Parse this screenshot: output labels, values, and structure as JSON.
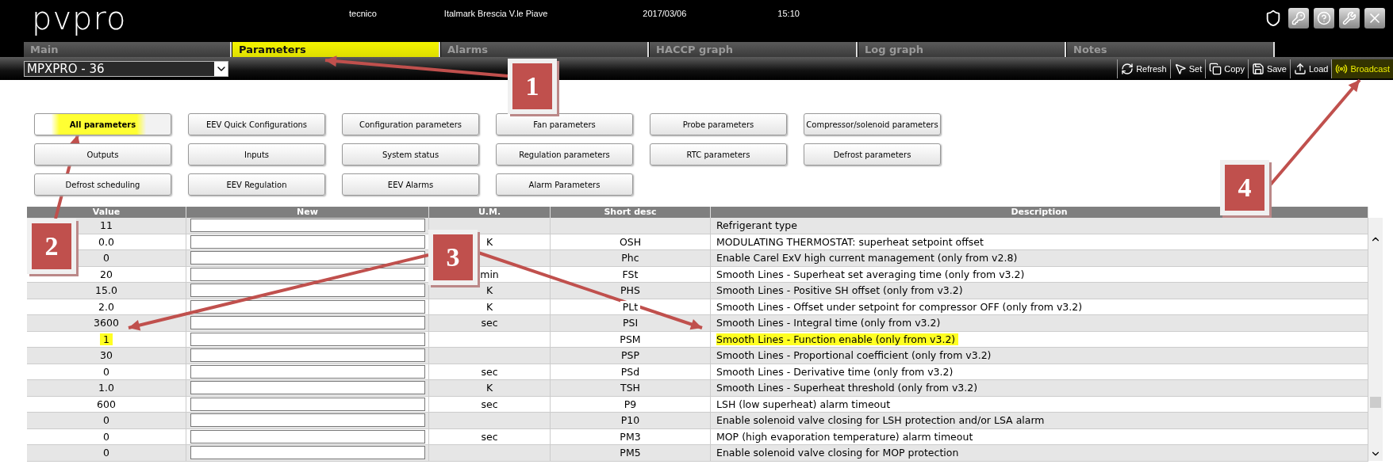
{
  "header": {
    "logo": "pvpro",
    "user": "tecnico",
    "site": "Italmark Brescia V.le Piave",
    "date": "2017/03/06",
    "time": "15:10"
  },
  "tabs": [
    {
      "label": "Main",
      "selected": false
    },
    {
      "label": "Parameters",
      "selected": true
    },
    {
      "label": "Alarms",
      "selected": false
    },
    {
      "label": "HACCP graph",
      "selected": false
    },
    {
      "label": "Log graph",
      "selected": false
    },
    {
      "label": "Notes",
      "selected": false
    }
  ],
  "device_select": {
    "value": "MPXPRO - 36"
  },
  "toolbar": [
    {
      "label": "Refresh",
      "kind": "refresh",
      "highlighted": false
    },
    {
      "label": "Set",
      "kind": "set",
      "highlighted": false
    },
    {
      "label": "Copy",
      "kind": "copy",
      "highlighted": false
    },
    {
      "label": "Save",
      "kind": "save",
      "highlighted": false
    },
    {
      "label": "Load",
      "kind": "load",
      "highlighted": false
    },
    {
      "label": "Broadcast",
      "kind": "broadcast",
      "highlighted": true
    }
  ],
  "categories": [
    {
      "label": "All parameters",
      "selected": true
    },
    {
      "label": "EEV Quick Configurations",
      "selected": false
    },
    {
      "label": "Configuration parameters",
      "selected": false
    },
    {
      "label": "Fan parameters",
      "selected": false
    },
    {
      "label": "Probe parameters",
      "selected": false
    },
    {
      "label": "Compressor/solenoid parameters",
      "selected": false
    },
    {
      "label": "Outputs",
      "selected": false
    },
    {
      "label": "Inputs",
      "selected": false
    },
    {
      "label": "System status",
      "selected": false
    },
    {
      "label": "Regulation parameters",
      "selected": false
    },
    {
      "label": "RTC parameters",
      "selected": false
    },
    {
      "label": "Defrost parameters",
      "selected": false
    },
    {
      "label": "Defrost scheduling",
      "selected": false
    },
    {
      "label": "EEV Regulation",
      "selected": false
    },
    {
      "label": "EEV Alarms",
      "selected": false
    },
    {
      "label": "Alarm Parameters",
      "selected": false
    }
  ],
  "table": {
    "columns": [
      "Value",
      "New",
      "U.M.",
      "Short desc",
      "Description"
    ],
    "rows": [
      {
        "value": "11",
        "um": "",
        "short": "",
        "description": "Refrigerant type",
        "highlighted": false
      },
      {
        "value": "0.0",
        "um": "K",
        "short": "OSH",
        "description": "MODULATING THERMOSTAT: superheat setpoint offset",
        "highlighted": false
      },
      {
        "value": "0",
        "um": "",
        "short": "Phc",
        "description": "Enable Carel ExV high current management (only from v2.8)",
        "highlighted": false
      },
      {
        "value": "20",
        "um": "min",
        "short": "FSt",
        "description": "Smooth Lines - Superheat set averaging time (only from v3.2)",
        "highlighted": false
      },
      {
        "value": "15.0",
        "um": "K",
        "short": "PHS",
        "description": "Smooth Lines - Positive SH offset (only from v3.2)",
        "highlighted": false
      },
      {
        "value": "2.0",
        "um": "K",
        "short": "PLt",
        "description": "Smooth Lines - Offset under setpoint for compressor OFF (only from v3.2)",
        "highlighted": false
      },
      {
        "value": "3600",
        "um": "sec",
        "short": "PSI",
        "description": "Smooth Lines - Integral time (only from v3.2)",
        "highlighted": false
      },
      {
        "value": "1",
        "um": "",
        "short": "PSM",
        "description": "Smooth Lines - Function enable (only from v3.2)",
        "highlighted": true
      },
      {
        "value": "30",
        "um": "",
        "short": "PSP",
        "description": "Smooth Lines - Proportional coefficient (only from v3.2)",
        "highlighted": false
      },
      {
        "value": "0",
        "um": "sec",
        "short": "PSd",
        "description": "Smooth Lines - Derivative time (only from v3.2)",
        "highlighted": false
      },
      {
        "value": "1.0",
        "um": "K",
        "short": "TSH",
        "description": "Smooth Lines - Superheat threshold (only from v3.2)",
        "highlighted": false
      },
      {
        "value": "600",
        "um": "sec",
        "short": "P9",
        "description": "LSH (low superheat) alarm timeout",
        "highlighted": false
      },
      {
        "value": "0",
        "um": "",
        "short": "P10",
        "description": "Enable solenoid valve closing for LSH protection and/or LSA alarm",
        "highlighted": false
      },
      {
        "value": "0",
        "um": "sec",
        "short": "PM3",
        "description": "MOP (high evaporation temperature) alarm timeout",
        "highlighted": false
      },
      {
        "value": "0",
        "um": "",
        "short": "PM5",
        "description": "Enable solenoid valve closing for MOP protection",
        "highlighted": false
      }
    ]
  },
  "callouts": [
    {
      "label": "1"
    },
    {
      "label": "2"
    },
    {
      "label": "3"
    },
    {
      "label": "4"
    }
  ]
}
